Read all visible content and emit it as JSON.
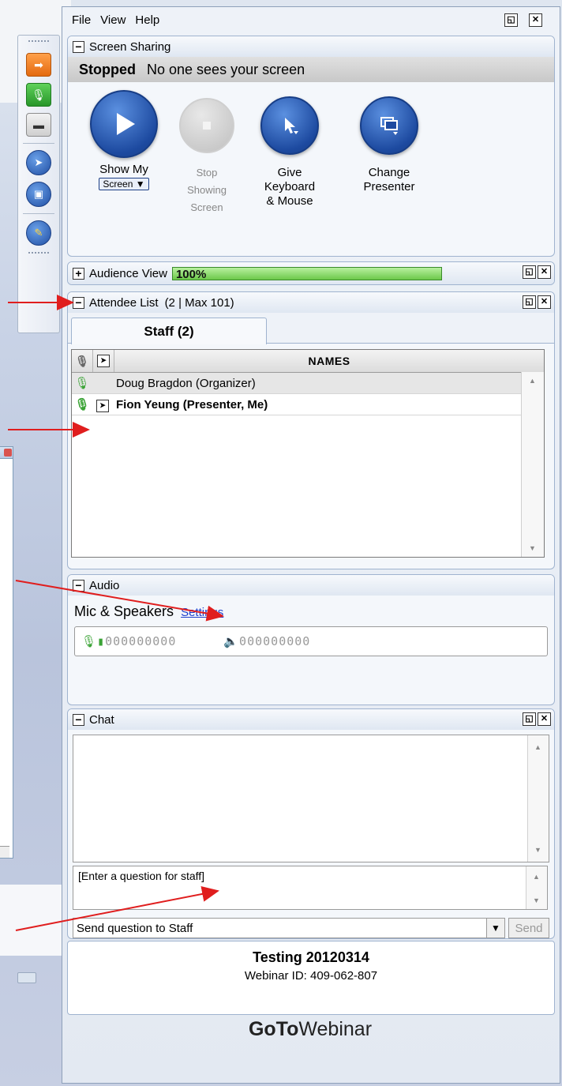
{
  "menu": {
    "file": "File",
    "view": "View",
    "help": "Help"
  },
  "screen_sharing": {
    "title": "Screen Sharing",
    "status_label": "Stopped",
    "status_text": "No one sees your screen",
    "buttons": [
      {
        "line1": "Show My",
        "line2": "Screen ▼"
      },
      {
        "line1": "Stop",
        "line2": "Showing",
        "line3": "Screen"
      },
      {
        "line1": "Give",
        "line2": "Keyboard",
        "line3": "& Mouse"
      },
      {
        "line1": "Change",
        "line2": "Presenter"
      }
    ]
  },
  "audience_view": {
    "title": "Audience View",
    "percent": "100%"
  },
  "attendee_list": {
    "title": "Attendee List",
    "count": "(2 | Max 101)",
    "tab": "Staff (2)",
    "col_names": "NAMES",
    "rows": [
      {
        "name": "Doug Bragdon (Organizer)"
      },
      {
        "name": "Fion Yeung (Presenter, Me)"
      }
    ]
  },
  "audio": {
    "title": "Audio",
    "mode": "Mic & Speakers",
    "settings_link": "Settings",
    "mic_level": "000000000",
    "speaker_level": "000000000"
  },
  "chat": {
    "title": "Chat",
    "input_placeholder": "[Enter a question for staff]",
    "send_to": "Send question to Staff",
    "send": "Send"
  },
  "webinar": {
    "title": "Testing 20120314",
    "id": "Webinar ID: 409-062-807",
    "brand_bold": "GoTo",
    "brand_light": "Webinar"
  }
}
